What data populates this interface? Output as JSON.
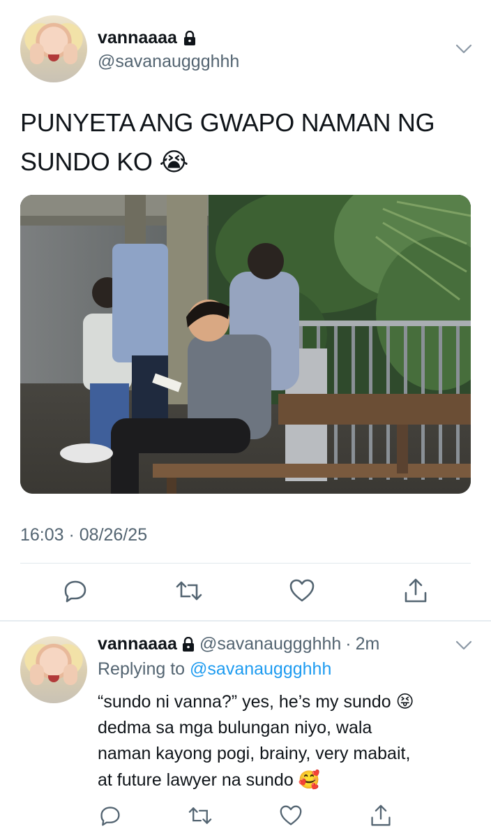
{
  "tweet": {
    "author": {
      "display_name": "vannaaaa",
      "handle": "@savanauggghhh",
      "protected": true
    },
    "text": "PUNYETA ANG GWAPO NAMAN NG SUNDO KO",
    "text_emoji": "😭",
    "timestamp": "16:03 · 08/26/25",
    "actions": {
      "reply": "reply-icon",
      "retweet": "retweet-icon",
      "like": "heart-icon",
      "share": "share-icon"
    }
  },
  "reply": {
    "author": {
      "display_name": "vannaaaa",
      "handle": "@savanauggghhh",
      "protected": true
    },
    "time_ago": "2m",
    "replying_to_prefix": "Replying to",
    "replying_to_handle": "@savanauggghhh",
    "line1": "“sundo ni vanna?” yes, he’s my sundo",
    "line1_emoji": "😝",
    "line2": "dedma sa mga bulungan niyo, wala",
    "line3": "naman kayong pogi, brainy, very mabait,",
    "line4": "at future lawyer na sundo",
    "line4_emoji": "🥰"
  },
  "colors": {
    "text": "#0f1419",
    "secondary": "#536471",
    "link": "#1d9bf0",
    "divider": "#e1e8ed"
  }
}
